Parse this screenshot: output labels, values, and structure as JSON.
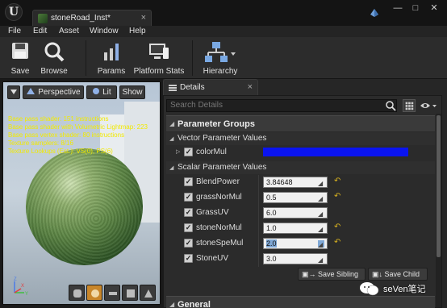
{
  "window": {
    "logo": "U",
    "tab_title": "stoneRoad_Inst*",
    "tab_close": "×",
    "minimize": "—",
    "maximize": "□",
    "close": "✕"
  },
  "menu": [
    "File",
    "Edit",
    "Asset",
    "Window",
    "Help"
  ],
  "toolbar": {
    "save": "Save",
    "browse": "Browse",
    "params": "Params",
    "platform_stats": "Platform Stats",
    "hierarchy": "Hierarchy"
  },
  "viewport": {
    "perspective": "Perspective",
    "lit": "Lit",
    "show": "Show",
    "stats": [
      "Base pass shader: 151 instructions",
      "Base pass shader with Volumetric Lightmap: 223",
      "Base pass vertex shader: 80 instructions",
      "Texture samplers: 8/16",
      "Texture Lookups (Est.): VS(0), PS(6)"
    ],
    "axes": {
      "z": "Z",
      "y": "Y",
      "x": "X"
    }
  },
  "details": {
    "tab": "Details",
    "search_placeholder": "Search Details",
    "section_title": "Parameter Groups",
    "vector_header": "Vector Parameter Values",
    "vector_params": [
      {
        "name": "colorMul",
        "color": "#0a14f0",
        "checked": true
      }
    ],
    "scalar_header": "Scalar Parameter Values",
    "scalar_params": [
      {
        "name": "BlendPower",
        "value": "3.84648",
        "checked": true,
        "modified": true
      },
      {
        "name": "grassNorMul",
        "value": "0.5",
        "checked": true,
        "modified": true
      },
      {
        "name": "GrassUV",
        "value": "6.0",
        "checked": true,
        "modified": false
      },
      {
        "name": "stoneNorMul",
        "value": "1.0",
        "checked": true,
        "modified": true
      },
      {
        "name": "stoneSpeMul",
        "value": "2.0",
        "checked": true,
        "modified": true
      },
      {
        "name": "StoneUV",
        "value": "3.0",
        "checked": true,
        "modified": false
      }
    ],
    "save_sibling": "Save Sibling",
    "save_child": "Save Child",
    "general": "General"
  },
  "watermark": "seVen笔记",
  "colors": {
    "accent_orange": "#c8862a",
    "stats_yellow": "#f2ea00",
    "reset_arrow": "#d9b320"
  }
}
